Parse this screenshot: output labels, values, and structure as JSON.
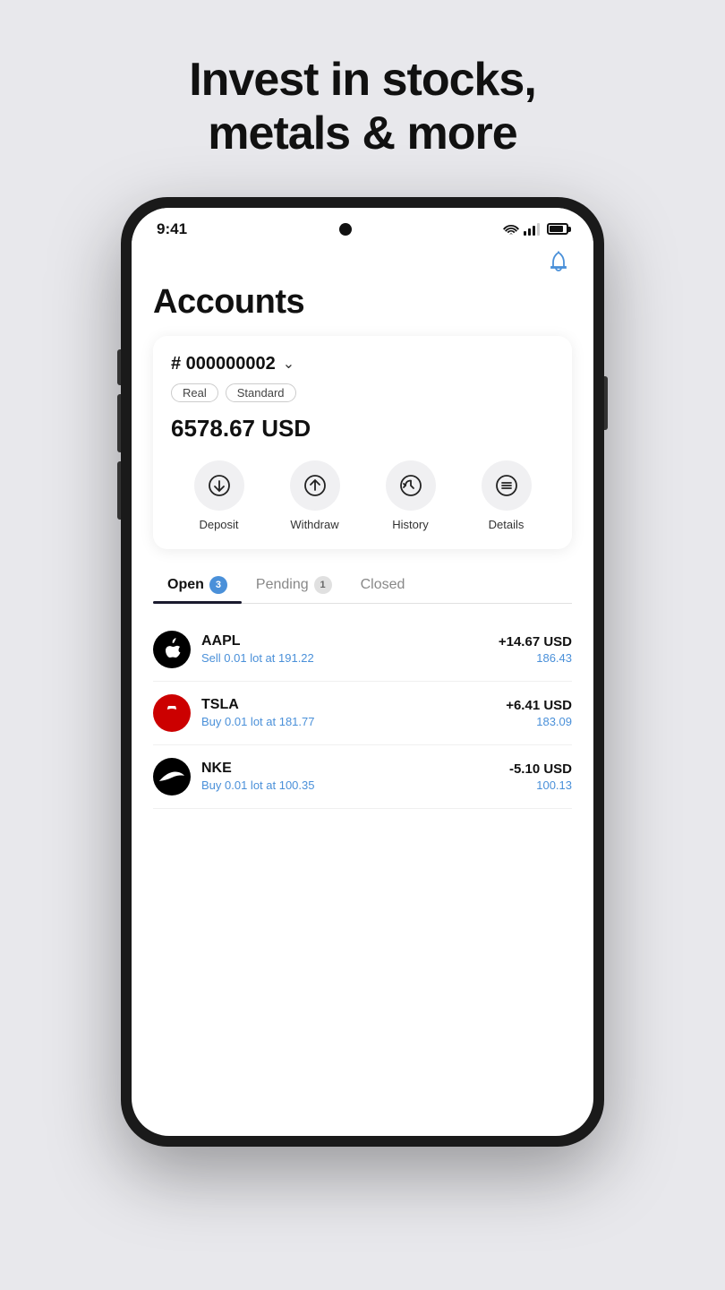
{
  "hero": {
    "line1": "Invest in stocks,",
    "line2": "metals & more"
  },
  "phone": {
    "status": {
      "time": "9:41"
    },
    "notification_icon": "🔔",
    "page_title": "Accounts",
    "account": {
      "number": "# 000000002",
      "tags": [
        "Real",
        "Standard"
      ],
      "balance": "6578.67 USD"
    },
    "action_buttons": [
      {
        "label": "Deposit",
        "icon": "deposit"
      },
      {
        "label": "Withdraw",
        "icon": "withdraw"
      },
      {
        "label": "History",
        "icon": "history"
      },
      {
        "label": "Details",
        "icon": "details"
      }
    ],
    "tabs": [
      {
        "label": "Open",
        "badge": "3",
        "active": true
      },
      {
        "label": "Pending",
        "badge": "1",
        "active": false
      },
      {
        "label": "Closed",
        "badge": "",
        "active": false
      }
    ],
    "trades": [
      {
        "symbol": "AAPL",
        "type": "apple",
        "detail": "Sell 0.01 lot at 191.22",
        "pnl": "+14.67 USD",
        "price": "186.43",
        "positive": true
      },
      {
        "symbol": "TSLA",
        "type": "tesla",
        "detail": "Buy 0.01 lot at 181.77",
        "pnl": "+6.41 USD",
        "price": "183.09",
        "positive": true
      },
      {
        "symbol": "NKE",
        "type": "nike",
        "detail": "Buy 0.01 lot at 100.35",
        "pnl": "-5.10 USD",
        "price": "100.13",
        "positive": false
      }
    ]
  }
}
